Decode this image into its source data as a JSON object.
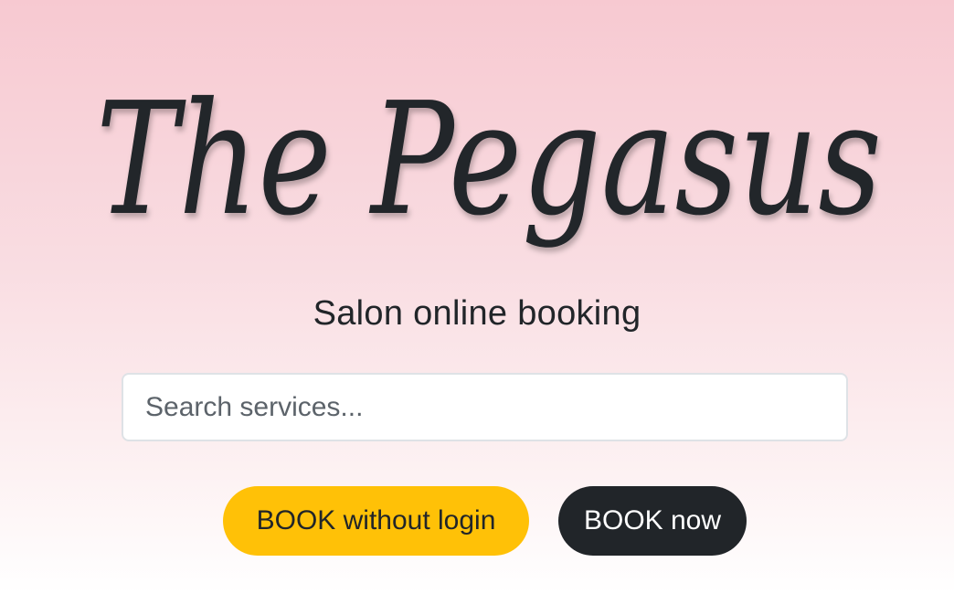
{
  "header": {
    "logo_text": "The Pegasus",
    "tagline": "Salon online booking"
  },
  "search": {
    "placeholder": "Search services...",
    "value": ""
  },
  "actions": {
    "guest_label": "BOOK without login",
    "book_label": "BOOK now"
  },
  "colors": {
    "primary_text": "#212529",
    "accent_yellow": "#ffc107",
    "dark_button": "#212529",
    "background_top": "#f7c9d1",
    "background_bottom": "#ffffff"
  }
}
